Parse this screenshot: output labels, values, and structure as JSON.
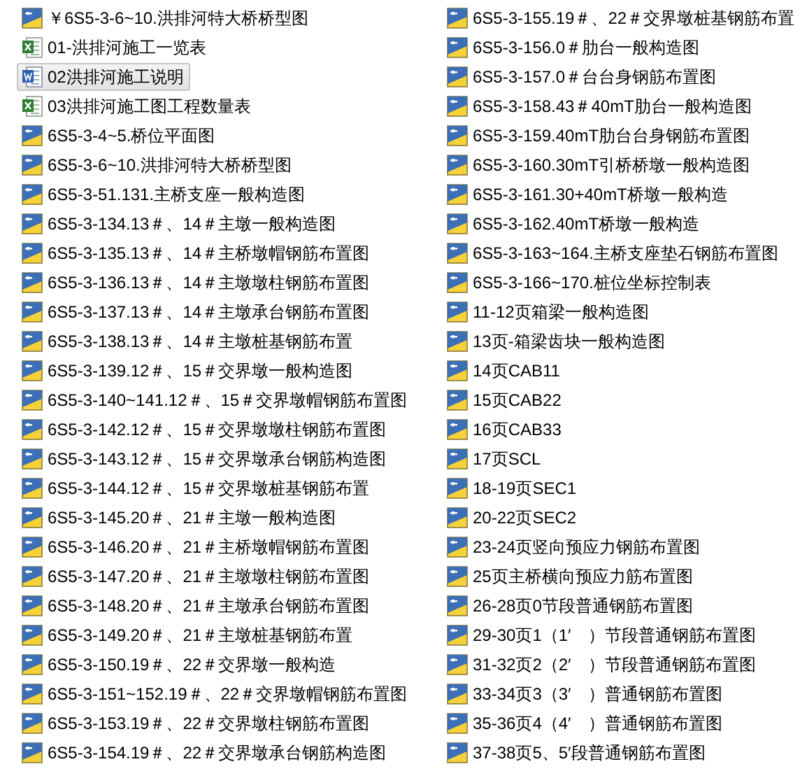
{
  "files": [
    {
      "name": "￥6S5-3-6~10.洪排河特大桥桥型图",
      "kind": "cad",
      "selected": false
    },
    {
      "name": "01-洪排河施工一览表",
      "kind": "excel",
      "selected": false
    },
    {
      "name": "02洪排河施工说明",
      "kind": "word",
      "selected": true
    },
    {
      "name": "03洪排河施工图工程数量表",
      "kind": "excel",
      "selected": false
    },
    {
      "name": "6S5-3-4~5.桥位平面图",
      "kind": "cad",
      "selected": false
    },
    {
      "name": "6S5-3-6~10.洪排河特大桥桥型图",
      "kind": "cad",
      "selected": false
    },
    {
      "name": "6S5-3-51.131.主桥支座一般构造图",
      "kind": "cad",
      "selected": false
    },
    {
      "name": "6S5-3-134.13＃、14＃主墩一般构造图",
      "kind": "cad",
      "selected": false
    },
    {
      "name": "6S5-3-135.13＃、14＃主桥墩帽钢筋布置图",
      "kind": "cad",
      "selected": false
    },
    {
      "name": "6S5-3-136.13＃、14＃主墩墩柱钢筋布置图",
      "kind": "cad",
      "selected": false
    },
    {
      "name": "6S5-3-137.13＃、14＃主墩承台钢筋布置图",
      "kind": "cad",
      "selected": false
    },
    {
      "name": "6S5-3-138.13＃、14＃主墩桩基钢筋布置",
      "kind": "cad",
      "selected": false
    },
    {
      "name": "6S5-3-139.12＃、15＃交界墩一般构造图",
      "kind": "cad",
      "selected": false
    },
    {
      "name": "6S5-3-140~141.12＃、15＃交界墩帽钢筋布置图",
      "kind": "cad",
      "selected": false
    },
    {
      "name": "6S5-3-142.12＃、15＃交界墩墩柱钢筋布置图",
      "kind": "cad",
      "selected": false
    },
    {
      "name": "6S5-3-143.12＃、15＃交界墩承台钢筋构造图",
      "kind": "cad",
      "selected": false
    },
    {
      "name": "6S5-3-144.12＃、15＃交界墩桩基钢筋布置",
      "kind": "cad",
      "selected": false
    },
    {
      "name": "6S5-3-145.20＃、21＃主墩一般构造图",
      "kind": "cad",
      "selected": false
    },
    {
      "name": "6S5-3-146.20＃、21＃主桥墩帽钢筋布置图",
      "kind": "cad",
      "selected": false
    },
    {
      "name": "6S5-3-147.20＃、21＃主墩墩柱钢筋布置图",
      "kind": "cad",
      "selected": false
    },
    {
      "name": "6S5-3-148.20＃、21＃主墩承台钢筋布置图",
      "kind": "cad",
      "selected": false
    },
    {
      "name": "6S5-3-149.20＃、21＃主墩桩基钢筋布置",
      "kind": "cad",
      "selected": false
    },
    {
      "name": "6S5-3-150.19＃、22＃交界墩一般构造",
      "kind": "cad",
      "selected": false
    },
    {
      "name": "6S5-3-151~152.19＃、22＃交界墩帽钢筋布置图",
      "kind": "cad",
      "selected": false
    },
    {
      "name": "6S5-3-153.19＃、22＃交界墩柱钢筋布置图",
      "kind": "cad",
      "selected": false
    },
    {
      "name": "6S5-3-154.19＃、22＃交界墩承台钢筋构造图",
      "kind": "cad",
      "selected": false
    },
    {
      "name": "6S5-3-155.19＃、22＃交界墩桩基钢筋布置",
      "kind": "cad",
      "selected": false
    },
    {
      "name": "6S5-3-156.0＃肋台一般构造图",
      "kind": "cad",
      "selected": false
    },
    {
      "name": "6S5-3-157.0＃台台身钢筋布置图",
      "kind": "cad",
      "selected": false
    },
    {
      "name": "6S5-3-158.43＃40mT肋台一般构造图",
      "kind": "cad",
      "selected": false
    },
    {
      "name": "6S5-3-159.40mT肋台台身钢筋布置图",
      "kind": "cad",
      "selected": false
    },
    {
      "name": "6S5-3-160.30mT引桥桥墩一般构造图",
      "kind": "cad",
      "selected": false
    },
    {
      "name": "6S5-3-161.30+40mT桥墩一般构造",
      "kind": "cad",
      "selected": false
    },
    {
      "name": "6S5-3-162.40mT桥墩一般构造",
      "kind": "cad",
      "selected": false
    },
    {
      "name": "6S5-3-163~164.主桥支座垫石钢筋布置图",
      "kind": "cad",
      "selected": false
    },
    {
      "name": "6S5-3-166~170.桩位坐标控制表",
      "kind": "cad",
      "selected": false
    },
    {
      "name": "11-12页箱梁一般构造图",
      "kind": "cad",
      "selected": false
    },
    {
      "name": "13页-箱梁齿块一般构造图",
      "kind": "cad",
      "selected": false
    },
    {
      "name": "14页CAB11",
      "kind": "cad",
      "selected": false
    },
    {
      "name": "15页CAB22",
      "kind": "cad",
      "selected": false
    },
    {
      "name": "16页CAB33",
      "kind": "cad",
      "selected": false
    },
    {
      "name": "17页SCL",
      "kind": "cad",
      "selected": false
    },
    {
      "name": "18-19页SEC1",
      "kind": "cad",
      "selected": false
    },
    {
      "name": "20-22页SEC2",
      "kind": "cad",
      "selected": false
    },
    {
      "name": "23-24页竖向预应力钢筋布置图",
      "kind": "cad",
      "selected": false
    },
    {
      "name": "25页主桥横向预应力筋布置图",
      "kind": "cad",
      "selected": false
    },
    {
      "name": "26-28页0节段普通钢筋布置图",
      "kind": "cad",
      "selected": false
    },
    {
      "name": "29-30页1（1′　）节段普通钢筋布置图",
      "kind": "cad",
      "selected": false
    },
    {
      "name": "31-32页2（2′　）节段普通钢筋布置图",
      "kind": "cad",
      "selected": false
    },
    {
      "name": "33-34页3（3′　）普通钢筋布置图",
      "kind": "cad",
      "selected": false
    },
    {
      "name": "35-36页4（4′　）普通钢筋布置图",
      "kind": "cad",
      "selected": false
    },
    {
      "name": "37-38页5、5′段普通钢筋布置图",
      "kind": "cad",
      "selected": false
    }
  ]
}
